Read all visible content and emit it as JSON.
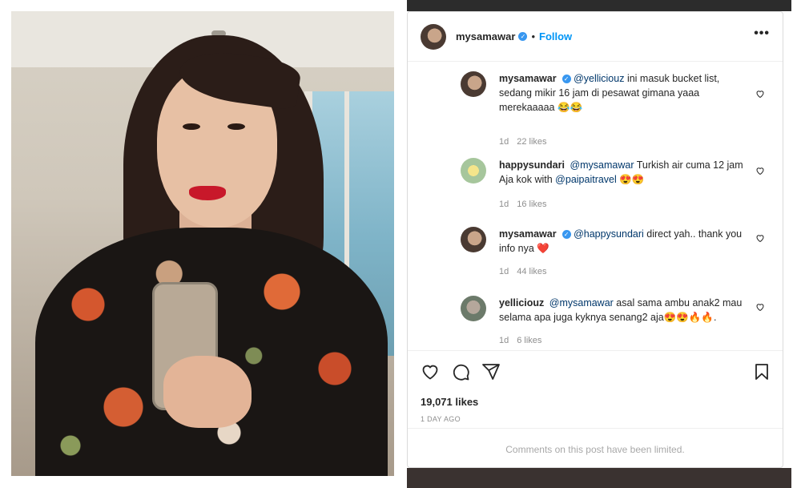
{
  "post": {
    "username": "mysamawar",
    "separator": "•",
    "follow_label": "Follow",
    "more_label": "•••"
  },
  "comments": [
    {
      "username": "mysamawar",
      "verified": true,
      "mention": "@yelliciouz",
      "text": " ini masuk bucket list, sedang mikir 16 jam di pesawat gimana yaaa merekaaaaa 😂😂",
      "age": "1d",
      "likes": "22 likes"
    },
    {
      "username": "happysundari",
      "verified": false,
      "mention": "@mysamawar",
      "text": " Turkish air cuma 12 jam Aja kok with ",
      "mention2": "@paipaitravel",
      "text2": " 😍😍",
      "age": "1d",
      "likes": "16 likes"
    },
    {
      "username": "mysamawar",
      "verified": true,
      "mention": "@happysundari",
      "text": " direct yah.. thank you info nya ❤️",
      "age": "1d",
      "likes": "44 likes"
    },
    {
      "username": "yelliciouz",
      "verified": false,
      "mention": "@mysamawar",
      "text": " asal sama ambu anak2 mau selama apa juga kyknya senang2 aja😍😍🔥🔥.",
      "age": "1d",
      "likes": "6 likes"
    }
  ],
  "actions": {
    "like_icon": "heart-icon",
    "comment_icon": "comment-icon",
    "share_icon": "share-icon",
    "save_icon": "bookmark-icon",
    "likes_count": "19,071 likes",
    "posted": "1 DAY AGO",
    "comments_limited": "Comments on this post have been limited."
  },
  "colors": {
    "link": "#0095f6",
    "mention": "#00376b",
    "verified": "#3897f0",
    "muted": "#8e8e8e"
  }
}
